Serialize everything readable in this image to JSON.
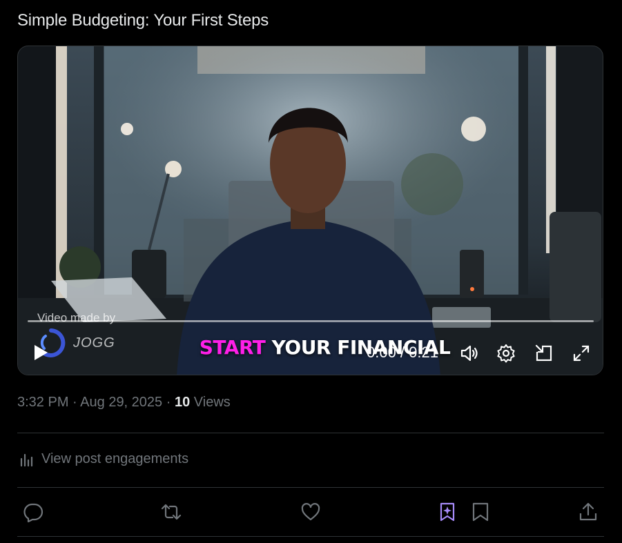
{
  "post": {
    "text": "Simple Budgeting: Your First Steps",
    "timestamp": "3:32 PM",
    "date": "Aug 29, 2025",
    "views_count": "10",
    "views_label": "Views",
    "separator": "·"
  },
  "video": {
    "caption_highlight": "START",
    "caption_rest": "YOUR FINANCIAL",
    "watermark_label": "Video made by",
    "watermark_brand": "JOGG",
    "time_display": "0:00 / 0:21",
    "progress": 0.0,
    "highlight_color": "#ff1fe8",
    "controls": [
      "play-icon",
      "volume-icon",
      "gear-icon",
      "picture-in-picture-icon",
      "fullscreen-icon"
    ]
  },
  "engagements": {
    "label": "View post engagements",
    "icon": "bar-chart-icon"
  },
  "actions": [
    {
      "name": "reply",
      "icon": "reply-icon"
    },
    {
      "name": "repost",
      "icon": "repost-icon"
    },
    {
      "name": "like",
      "icon": "heart-icon"
    },
    {
      "name": "grok-bookmark",
      "icon": "grok-icon",
      "color": "#a78bfa"
    },
    {
      "name": "bookmark",
      "icon": "bookmark-icon"
    },
    {
      "name": "share",
      "icon": "share-icon"
    }
  ],
  "colors": {
    "background": "#000000",
    "text_primary": "#e7e9ea",
    "text_secondary": "#71767b",
    "divider": "#2f3336"
  }
}
